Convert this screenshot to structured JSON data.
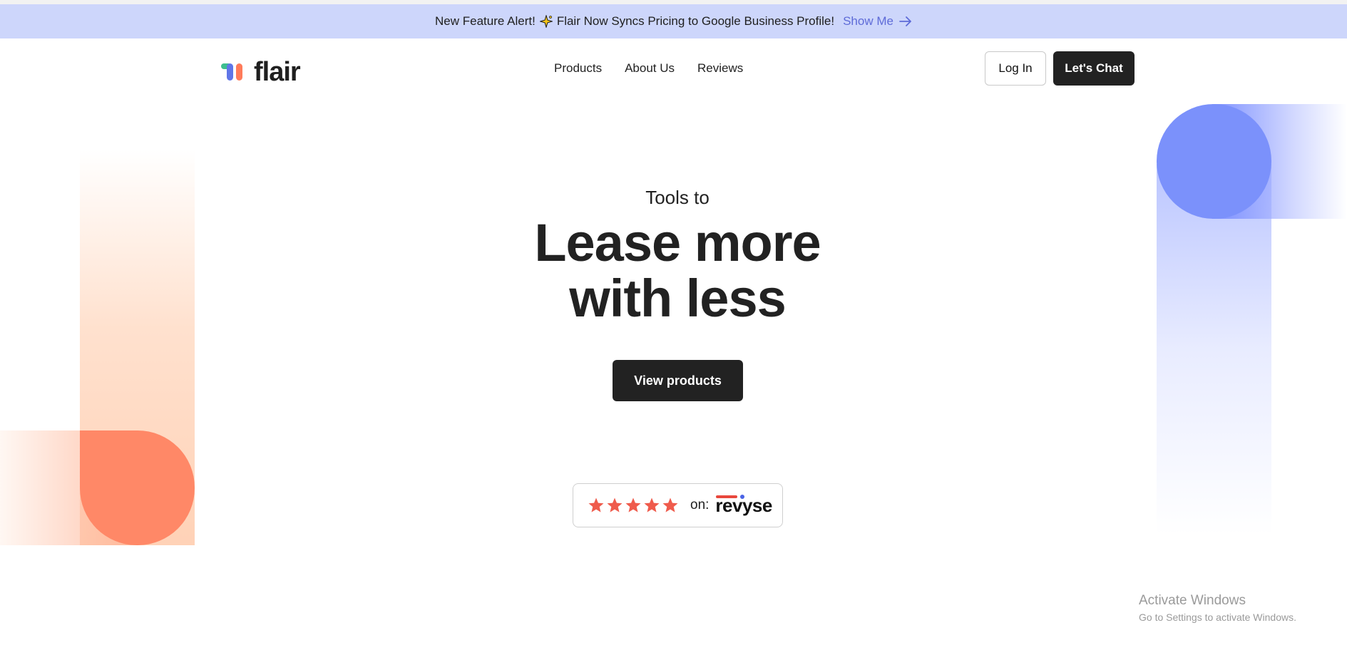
{
  "banner": {
    "text": "New Feature Alert!",
    "icon": "sparkle-icon",
    "message": "Flair Now Syncs Pricing to Google Business Profile!",
    "link_label": "Show Me",
    "link_icon": "arrow-right-icon"
  },
  "header": {
    "logo_text": "flair",
    "nav": [
      "Products",
      "About Us",
      "Reviews"
    ],
    "login_label": "Log In",
    "chat_label": "Let's Chat"
  },
  "hero": {
    "subtitle": "Tools to",
    "title_word1": "Lease",
    "title_highlight": "more",
    "title_line2": "with less",
    "cta_label": "View products"
  },
  "rating": {
    "stars": 5,
    "on_label": "on:",
    "brand": "revyse"
  },
  "windows_notice": {
    "title": "Activate Windows",
    "subtitle": "Go to Settings to activate Windows."
  },
  "colors": {
    "banner_bg": "#cdd6fb",
    "link": "#5e6bd8",
    "dark": "#222222",
    "star": "#ef5b4c",
    "coral": "#ff8867",
    "periwinkle": "#7b91fb"
  }
}
